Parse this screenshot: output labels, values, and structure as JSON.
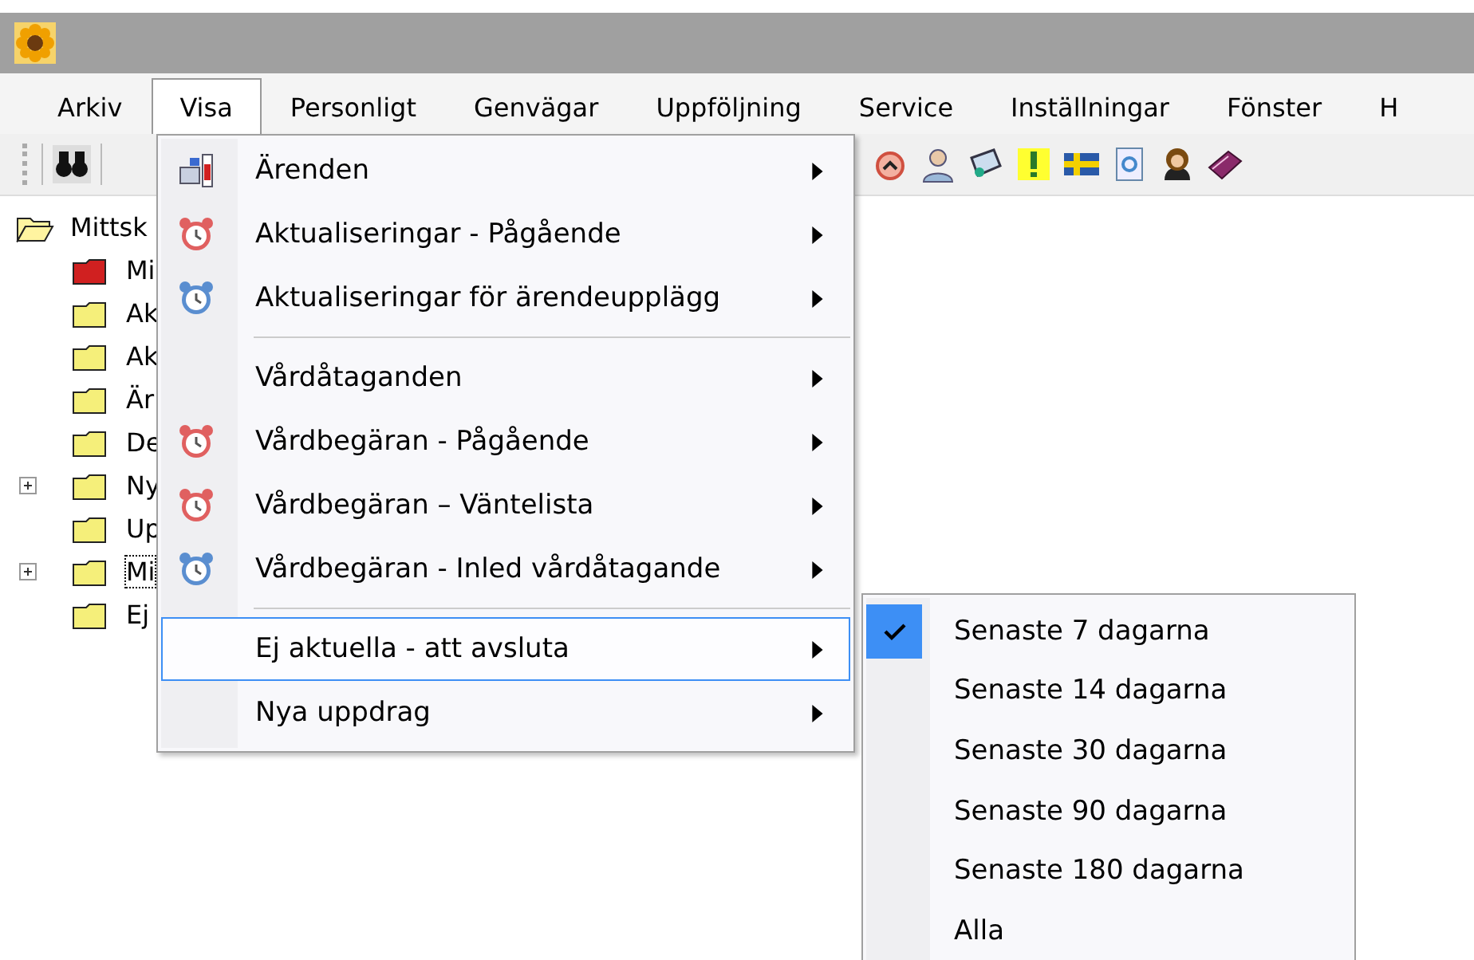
{
  "menu_bar": [
    {
      "label": "Arkiv",
      "selected": false
    },
    {
      "label": "Visa",
      "selected": true
    },
    {
      "label": "Personligt",
      "selected": false
    },
    {
      "label": "Genvägar",
      "selected": false
    },
    {
      "label": "Uppföljning",
      "selected": false
    },
    {
      "label": "Service",
      "selected": false
    },
    {
      "label": "Inställningar",
      "selected": false
    },
    {
      "label": "Fönster",
      "selected": false
    },
    {
      "label": "H",
      "selected": false
    }
  ],
  "tree": {
    "label": "Mittsk",
    "children": [
      {
        "label": "Mi",
        "color": "#d02020",
        "expandable": false,
        "focused": false
      },
      {
        "label": "Ak",
        "color": "#f5ef7a",
        "expandable": false,
        "focused": false
      },
      {
        "label": "Ak",
        "color": "#f5ef7a",
        "expandable": false,
        "focused": false
      },
      {
        "label": "Är",
        "color": "#f5ef7a",
        "expandable": false,
        "focused": false
      },
      {
        "label": "De",
        "color": "#f5ef7a",
        "expandable": false,
        "focused": false
      },
      {
        "label": "Ny",
        "color": "#f5ef7a",
        "expandable": true,
        "focused": false
      },
      {
        "label": "Up",
        "color": "#f5ef7a",
        "expandable": false,
        "focused": false
      },
      {
        "label": "Mi",
        "color": "#f5ef7a",
        "expandable": true,
        "focused": true
      },
      {
        "label": "Ej",
        "color": "#f5ef7a",
        "expandable": false,
        "focused": false
      }
    ]
  },
  "visa_menu": [
    {
      "kind": "chart_item",
      "label": "Ärenden",
      "highlighted": false
    },
    {
      "kind": "alarm_item",
      "label": "Aktualiseringar - Pågående",
      "color": "#e06060",
      "highlighted": false
    },
    {
      "kind": "alarm_item",
      "label": "Aktualiseringar för ärendeupplägg",
      "color": "#5a8ed0",
      "highlighted": false
    },
    {
      "kind": "separator"
    },
    {
      "kind": "item",
      "label": "Vårdåtaganden",
      "highlighted": false
    },
    {
      "kind": "alarm_item",
      "label": "Vårdbegäran - Pågående",
      "color": "#e06060",
      "highlighted": false
    },
    {
      "kind": "alarm_item",
      "label": "Vårdbegäran – Väntelista",
      "color": "#e06060",
      "highlighted": false
    },
    {
      "kind": "alarm_item",
      "label": "Vårdbegäran - Inled vårdåtagande",
      "color": "#5a8ed0",
      "highlighted": false
    },
    {
      "kind": "separator"
    },
    {
      "kind": "item",
      "label": "Ej aktuella - att avsluta",
      "highlighted": true
    },
    {
      "kind": "item",
      "label": "Nya uppdrag",
      "highlighted": false
    }
  ],
  "submenu": [
    {
      "label": "Senaste 7 dagarna",
      "checked": true
    },
    {
      "label": "Senaste 14 dagarna",
      "checked": false
    },
    {
      "label": "Senaste 30 dagarna",
      "checked": false
    },
    {
      "label": "Senaste 90 dagarna",
      "checked": false
    },
    {
      "label": "Senaste 180 dagarna",
      "checked": false
    },
    {
      "label": "Alla",
      "checked": false
    }
  ]
}
